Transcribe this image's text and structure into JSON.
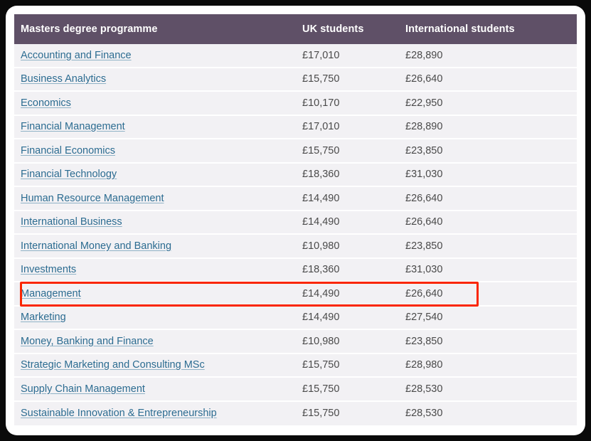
{
  "table": {
    "columns": [
      {
        "key": "programme",
        "label": "Masters degree programme"
      },
      {
        "key": "uk",
        "label": "UK students"
      },
      {
        "key": "intl",
        "label": "International students"
      }
    ],
    "rows": [
      {
        "programme": "Accounting and Finance",
        "uk": "£17,010",
        "intl": "£28,890",
        "highlighted": false
      },
      {
        "programme": "Business Analytics",
        "uk": "£15,750",
        "intl": "£26,640",
        "highlighted": false
      },
      {
        "programme": "Economics",
        "uk": "£10,170",
        "intl": "£22,950",
        "highlighted": false
      },
      {
        "programme": "Financial Management",
        "uk": "£17,010",
        "intl": "£28,890",
        "highlighted": false
      },
      {
        "programme": "Financial Economics",
        "uk": "£15,750",
        "intl": "£23,850",
        "highlighted": false
      },
      {
        "programme": "Financial Technology",
        "uk": "£18,360",
        "intl": "£31,030",
        "highlighted": false
      },
      {
        "programme": "Human Resource Management",
        "uk": "£14,490",
        "intl": "£26,640",
        "highlighted": false
      },
      {
        "programme": "International Business",
        "uk": "£14,490",
        "intl": "£26,640",
        "highlighted": false
      },
      {
        "programme": "International Money and Banking",
        "uk": "£10,980",
        "intl": "£23,850",
        "highlighted": false
      },
      {
        "programme": "Investments",
        "uk": "£18,360",
        "intl": "£31,030",
        "highlighted": false
      },
      {
        "programme": "Management",
        "uk": "£14,490",
        "intl": "£26,640",
        "highlighted": true
      },
      {
        "programme": "Marketing",
        "uk": "£14,490",
        "intl": "£27,540",
        "highlighted": false
      },
      {
        "programme": "Money, Banking and Finance",
        "uk": "£10,980",
        "intl": "£23,850",
        "highlighted": false
      },
      {
        "programme": "Strategic Marketing and Consulting MSc",
        "uk": "£15,750",
        "intl": "£28,980",
        "highlighted": false
      },
      {
        "programme": "Supply Chain Management",
        "uk": "£15,750",
        "intl": "£28,530",
        "highlighted": false
      },
      {
        "programme": "Sustainable Innovation & Entrepreneurship",
        "uk": "£15,750",
        "intl": "£28,530",
        "highlighted": false
      }
    ]
  },
  "colors": {
    "header_background": "#5f5067",
    "header_text": "#ffffff",
    "row_background": "#f2f1f4",
    "row_divider": "#ffffff",
    "link_text": "#2c6c91",
    "value_text": "#4a4a4a",
    "card_background": "#ffffff",
    "page_background": "#0a0a0a",
    "highlight_border": "#fa2600"
  }
}
